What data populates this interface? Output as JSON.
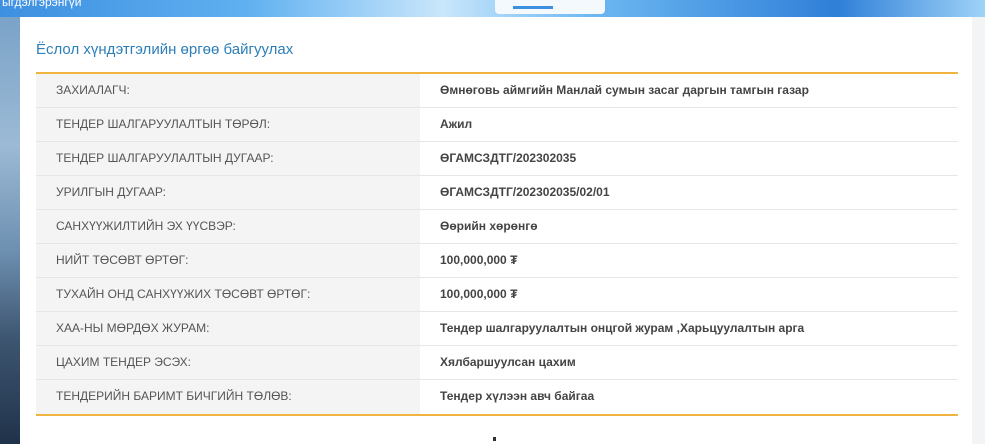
{
  "banner": {
    "text": "ыгдэлгэрэнгүй"
  },
  "section": {
    "title": "Ёслол хүндэтгэлийн өргөө байгуулах"
  },
  "rows": [
    {
      "label": "ЗАХИАЛАГЧ:",
      "value": "Өмнөговь аймгийн Манлай сумын засаг даргын тамгын газар"
    },
    {
      "label": "ТЕНДЕР ШАЛГАРУУЛАЛТЫН ТӨРӨЛ:",
      "value": "Ажил"
    },
    {
      "label": "ТЕНДЕР ШАЛГАРУУЛАЛТЫН ДУГААР:",
      "value": "ӨГАМСЗДТГ/202302035"
    },
    {
      "label": "УРИЛГЫН ДУГААР:",
      "value": "ӨГАМСЗДТГ/202302035/02/01"
    },
    {
      "label": "САНХҮҮЖИЛТИЙН ЭХ ҮҮСВЭР:",
      "value": "Өөрийн хөрөнгө"
    },
    {
      "label": "НИЙТ ТӨСӨВТ ӨРТӨГ:",
      "value": "100,000,000 ₮"
    },
    {
      "label": "ТУХАЙН ОНД САНХҮҮЖИХ ТӨСӨВТ ӨРТӨГ:",
      "value": "100,000,000 ₮"
    },
    {
      "label": "ХАА-НЫ МӨРДӨХ ЖУРАМ:",
      "value": "Тендер шалгаруулалтын онцгой журам ,Харьцуулалтын арга"
    },
    {
      "label": "ЦАХИМ ТЕНДЕР ЭСЭХ:",
      "value": "Хялбаршуулсан цахим"
    },
    {
      "label": "ТЕНДЕРИЙН БАРИМТ БИЧГИЙН ТӨЛӨВ:",
      "value": "Тендер хүлээн авч байгаа"
    }
  ],
  "colors": {
    "accent": "#f0b440",
    "title": "#2d7fb8",
    "label_bg": "#f4f4f4"
  }
}
